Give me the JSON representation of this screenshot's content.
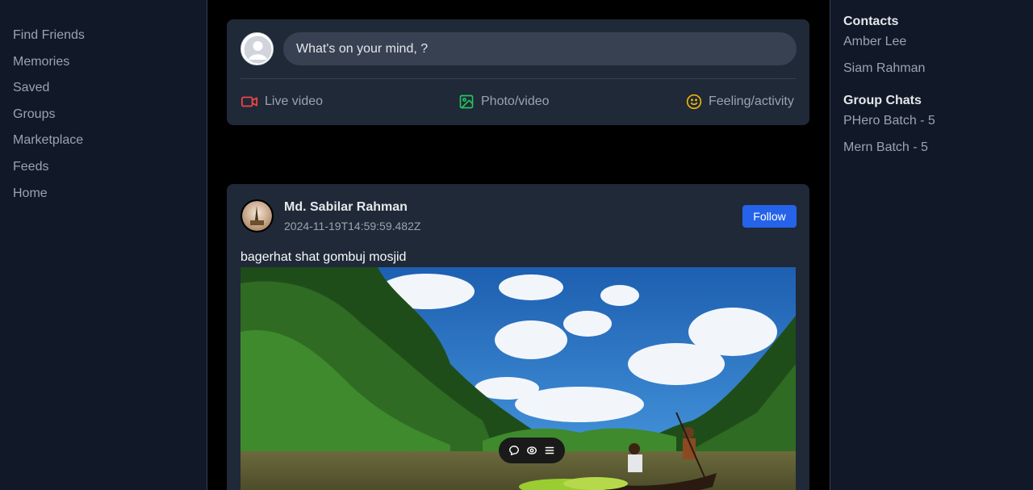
{
  "left_nav": {
    "items": [
      "Find Friends",
      "Memories",
      "Saved",
      "Groups",
      "Marketplace",
      "Feeds",
      "Home"
    ]
  },
  "composer": {
    "placeholder": "What's on your mind, ?",
    "actions": {
      "live": "Live video",
      "photo": "Photo/video",
      "feeling": "Feeling/activity"
    },
    "colors": {
      "live": "#ef4444",
      "photo": "#22c55e",
      "feeling": "#eab308"
    }
  },
  "post": {
    "author": "Md. Sabilar Rahman",
    "timestamp": "2024-11-19T14:59:59.482Z",
    "follow_label": "Follow",
    "caption": "bagerhat shat gombuj mosjid",
    "toolbar_icons": [
      "comment-icon",
      "view-icon",
      "menu-icon"
    ]
  },
  "right_panel": {
    "contacts_heading": "Contacts",
    "contacts": [
      "Amber Lee",
      "Siam Rahman"
    ],
    "group_chats_heading": "Group Chats",
    "group_chats": [
      "PHero Batch - 5",
      "Mern Batch - 5"
    ]
  },
  "colors": {
    "accent": "#2563eb",
    "panel": "#1f2937",
    "sidebar": "#111827"
  }
}
